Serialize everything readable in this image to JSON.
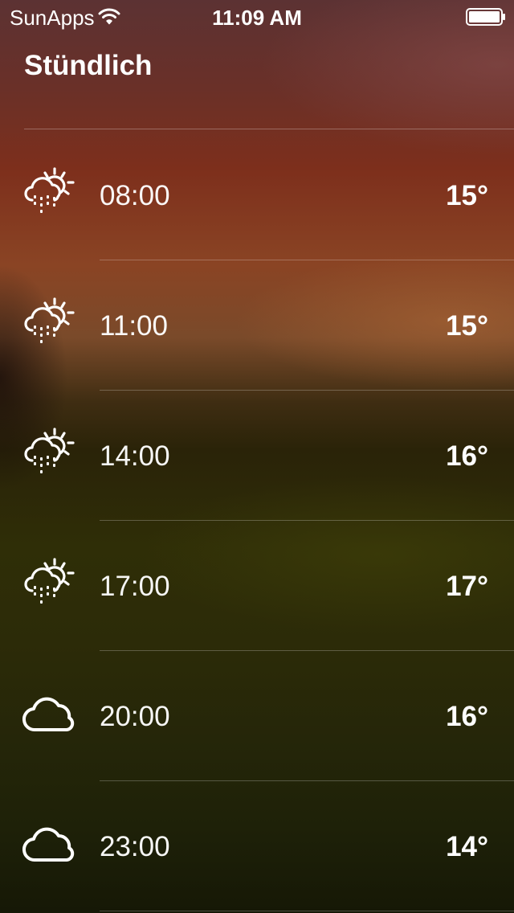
{
  "status_bar": {
    "carrier": "SunApps",
    "time": "11:09 AM",
    "wifi_icon": "wifi-icon",
    "battery_icon": "battery-icon"
  },
  "header": {
    "title": "Stündlich"
  },
  "hours": [
    {
      "time": "08:00",
      "temp": "15°",
      "icon": "sun-cloud-rain-icon"
    },
    {
      "time": "11:00",
      "temp": "15°",
      "icon": "sun-cloud-rain-icon"
    },
    {
      "time": "14:00",
      "temp": "16°",
      "icon": "sun-cloud-rain-icon"
    },
    {
      "time": "17:00",
      "temp": "17°",
      "icon": "sun-cloud-rain-icon"
    },
    {
      "time": "20:00",
      "temp": "16°",
      "icon": "cloud-icon"
    },
    {
      "time": "23:00",
      "temp": "14°",
      "icon": "cloud-icon"
    }
  ]
}
